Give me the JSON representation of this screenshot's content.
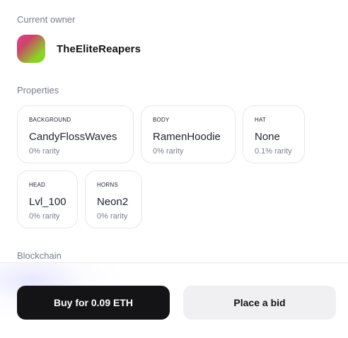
{
  "owner": {
    "section_label": "Current owner",
    "name": "TheEliteReapers"
  },
  "properties": {
    "section_label": "Properties",
    "items": [
      {
        "type": "BACKGROUND",
        "value": "CandyFlossWaves",
        "rarity": "0% rarity"
      },
      {
        "type": "BODY",
        "value": "RamenHoodie",
        "rarity": "0% rarity"
      },
      {
        "type": "HAT",
        "value": "None",
        "rarity": "0.1% rarity"
      },
      {
        "type": "HEAD",
        "value": "Lvl_100",
        "rarity": "0% rarity"
      },
      {
        "type": "HORNS",
        "value": "Neon2",
        "rarity": "0% rarity"
      }
    ]
  },
  "blockchain": {
    "section_label": "Blockchain"
  },
  "actions": {
    "buy_label": "Buy for 0.09 ETH",
    "bid_label": "Place a bid"
  },
  "colors": {
    "primary_button": "#141416",
    "secondary_button": "#f0f0f2",
    "muted_text": "#777e90",
    "card_border": "#e6e8ec"
  }
}
